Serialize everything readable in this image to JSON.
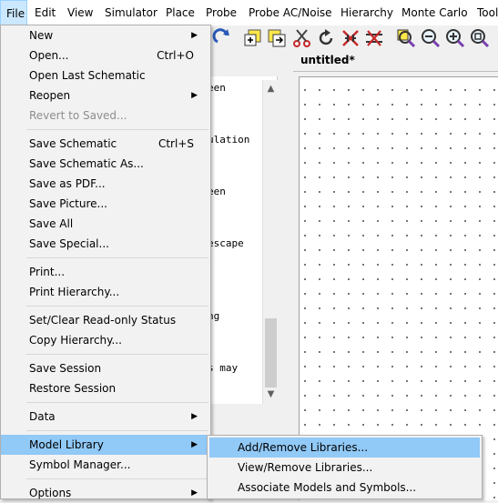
{
  "menubar": {
    "items": [
      "File",
      "Edit",
      "View",
      "Simulator",
      "Place",
      "Probe",
      "Probe AC/Noise",
      "Hierarchy",
      "Monte Carlo",
      "Tool"
    ]
  },
  "toolbar": {
    "icons": [
      "redo-icon",
      "add-part-icon",
      "import-icon",
      "cut-icon",
      "rotate-icon",
      "component-icon",
      "wire-icon",
      "zoom-area-icon",
      "zoom-out-icon",
      "zoom-in-icon",
      "zoom-fit-icon"
    ]
  },
  "console": {
    "lines": [
      "een",
      "ulation",
      "een",
      "escape",
      "ng",
      "s may"
    ]
  },
  "schematic": {
    "tab_title": "untitled*"
  },
  "file_menu": {
    "new": "New",
    "open": "Open...",
    "open_sc": "Ctrl+O",
    "open_last": "Open Last Schematic",
    "reopen": "Reopen",
    "revert": "Revert to Saved...",
    "save": "Save Schematic",
    "save_sc": "Ctrl+S",
    "save_as": "Save Schematic As...",
    "save_pdf": "Save as PDF...",
    "save_picture": "Save Picture...",
    "save_all": "Save All",
    "save_special": "Save Special...",
    "print": "Print...",
    "print_hierarchy": "Print Hierarchy...",
    "readonly": "Set/Clear Read-only Status",
    "copy_hierarchy": "Copy Hierarchy...",
    "save_session": "Save Session",
    "restore_session": "Restore Session",
    "data": "Data",
    "model_library": "Model Library",
    "symbol_manager": "Symbol Manager...",
    "options": "Options"
  },
  "submenu": {
    "add_remove": "Add/Remove Libraries...",
    "view_remove": "View/Remove Libraries...",
    "associate": "Associate Models and Symbols..."
  },
  "colors": {
    "highlight": "#91c9f7",
    "menubar_active": "#cce8ff",
    "disabled": "#8d8d8d"
  }
}
